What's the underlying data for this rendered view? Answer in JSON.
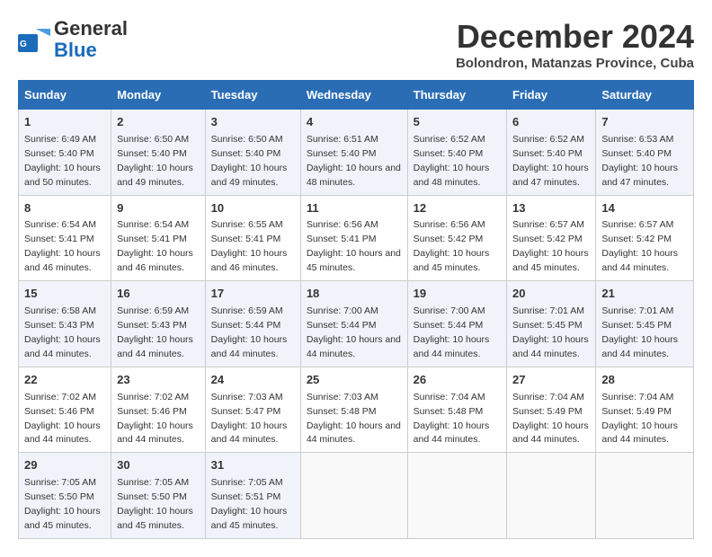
{
  "logo": {
    "general": "General",
    "blue": "Blue"
  },
  "header": {
    "month": "December 2024",
    "location": "Bolondron, Matanzas Province, Cuba"
  },
  "days_of_week": [
    "Sunday",
    "Monday",
    "Tuesday",
    "Wednesday",
    "Thursday",
    "Friday",
    "Saturday"
  ],
  "weeks": [
    [
      {
        "day": "1",
        "sunrise": "6:49 AM",
        "sunset": "5:40 PM",
        "daylight": "10 hours and 50 minutes."
      },
      {
        "day": "2",
        "sunrise": "6:50 AM",
        "sunset": "5:40 PM",
        "daylight": "10 hours and 49 minutes."
      },
      {
        "day": "3",
        "sunrise": "6:50 AM",
        "sunset": "5:40 PM",
        "daylight": "10 hours and 49 minutes."
      },
      {
        "day": "4",
        "sunrise": "6:51 AM",
        "sunset": "5:40 PM",
        "daylight": "10 hours and 48 minutes."
      },
      {
        "day": "5",
        "sunrise": "6:52 AM",
        "sunset": "5:40 PM",
        "daylight": "10 hours and 48 minutes."
      },
      {
        "day": "6",
        "sunrise": "6:52 AM",
        "sunset": "5:40 PM",
        "daylight": "10 hours and 47 minutes."
      },
      {
        "day": "7",
        "sunrise": "6:53 AM",
        "sunset": "5:40 PM",
        "daylight": "10 hours and 47 minutes."
      }
    ],
    [
      {
        "day": "8",
        "sunrise": "6:54 AM",
        "sunset": "5:41 PM",
        "daylight": "10 hours and 46 minutes."
      },
      {
        "day": "9",
        "sunrise": "6:54 AM",
        "sunset": "5:41 PM",
        "daylight": "10 hours and 46 minutes."
      },
      {
        "day": "10",
        "sunrise": "6:55 AM",
        "sunset": "5:41 PM",
        "daylight": "10 hours and 46 minutes."
      },
      {
        "day": "11",
        "sunrise": "6:56 AM",
        "sunset": "5:41 PM",
        "daylight": "10 hours and 45 minutes."
      },
      {
        "day": "12",
        "sunrise": "6:56 AM",
        "sunset": "5:42 PM",
        "daylight": "10 hours and 45 minutes."
      },
      {
        "day": "13",
        "sunrise": "6:57 AM",
        "sunset": "5:42 PM",
        "daylight": "10 hours and 45 minutes."
      },
      {
        "day": "14",
        "sunrise": "6:57 AM",
        "sunset": "5:42 PM",
        "daylight": "10 hours and 44 minutes."
      }
    ],
    [
      {
        "day": "15",
        "sunrise": "6:58 AM",
        "sunset": "5:43 PM",
        "daylight": "10 hours and 44 minutes."
      },
      {
        "day": "16",
        "sunrise": "6:59 AM",
        "sunset": "5:43 PM",
        "daylight": "10 hours and 44 minutes."
      },
      {
        "day": "17",
        "sunrise": "6:59 AM",
        "sunset": "5:44 PM",
        "daylight": "10 hours and 44 minutes."
      },
      {
        "day": "18",
        "sunrise": "7:00 AM",
        "sunset": "5:44 PM",
        "daylight": "10 hours and 44 minutes."
      },
      {
        "day": "19",
        "sunrise": "7:00 AM",
        "sunset": "5:44 PM",
        "daylight": "10 hours and 44 minutes."
      },
      {
        "day": "20",
        "sunrise": "7:01 AM",
        "sunset": "5:45 PM",
        "daylight": "10 hours and 44 minutes."
      },
      {
        "day": "21",
        "sunrise": "7:01 AM",
        "sunset": "5:45 PM",
        "daylight": "10 hours and 44 minutes."
      }
    ],
    [
      {
        "day": "22",
        "sunrise": "7:02 AM",
        "sunset": "5:46 PM",
        "daylight": "10 hours and 44 minutes."
      },
      {
        "day": "23",
        "sunrise": "7:02 AM",
        "sunset": "5:46 PM",
        "daylight": "10 hours and 44 minutes."
      },
      {
        "day": "24",
        "sunrise": "7:03 AM",
        "sunset": "5:47 PM",
        "daylight": "10 hours and 44 minutes."
      },
      {
        "day": "25",
        "sunrise": "7:03 AM",
        "sunset": "5:48 PM",
        "daylight": "10 hours and 44 minutes."
      },
      {
        "day": "26",
        "sunrise": "7:04 AM",
        "sunset": "5:48 PM",
        "daylight": "10 hours and 44 minutes."
      },
      {
        "day": "27",
        "sunrise": "7:04 AM",
        "sunset": "5:49 PM",
        "daylight": "10 hours and 44 minutes."
      },
      {
        "day": "28",
        "sunrise": "7:04 AM",
        "sunset": "5:49 PM",
        "daylight": "10 hours and 44 minutes."
      }
    ],
    [
      {
        "day": "29",
        "sunrise": "7:05 AM",
        "sunset": "5:50 PM",
        "daylight": "10 hours and 45 minutes."
      },
      {
        "day": "30",
        "sunrise": "7:05 AM",
        "sunset": "5:50 PM",
        "daylight": "10 hours and 45 minutes."
      },
      {
        "day": "31",
        "sunrise": "7:05 AM",
        "sunset": "5:51 PM",
        "daylight": "10 hours and 45 minutes."
      },
      null,
      null,
      null,
      null
    ]
  ]
}
